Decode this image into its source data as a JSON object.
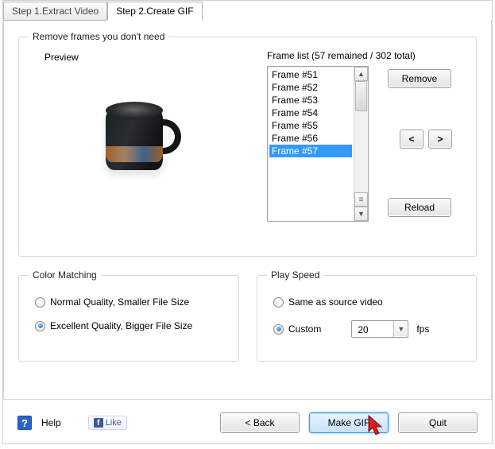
{
  "tabs": {
    "step1": "Step 1.Extract Video",
    "step2": "Step 2.Create GIF"
  },
  "remove_section": {
    "legend": "Remove frames you don't need",
    "preview_label": "Preview",
    "frame_list_title": "Frame list (57 remained / 302 total)",
    "frames": [
      "Frame #51",
      "Frame #52",
      "Frame #53",
      "Frame #54",
      "Frame #55",
      "Frame #56",
      "Frame #57"
    ],
    "selected_index": 6,
    "remove_btn": "Remove",
    "prev_btn": "<",
    "next_btn": ">",
    "reload_btn": "Reload"
  },
  "color_section": {
    "legend": "Color Matching",
    "opt_normal": "Normal Quality, Smaller File Size",
    "opt_excellent": "Excellent Quality, Bigger File Size",
    "selected": "excellent"
  },
  "play_section": {
    "legend": "Play Speed",
    "opt_same": "Same as source video",
    "opt_custom": "Custom",
    "selected": "custom",
    "fps_value": "20",
    "fps_unit": "fps"
  },
  "footer": {
    "help": "Help",
    "like": "Like",
    "back": "< Back",
    "make": "Make GIF",
    "quit": "Quit"
  }
}
